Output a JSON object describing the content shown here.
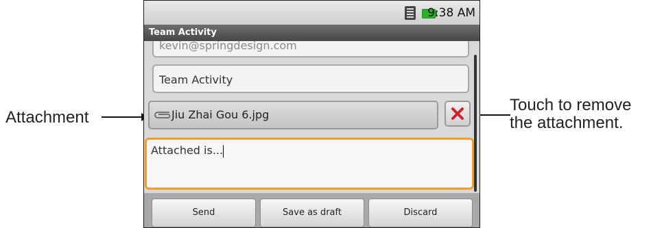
{
  "annotations": {
    "attachment_label": "Attachment",
    "remove_label_line1": "Touch to remove",
    "remove_label_line2": "the attachment."
  },
  "status_bar": {
    "time": "9:38 AM",
    "icons": [
      "signal-icon",
      "battery-icon"
    ]
  },
  "title_bar": {
    "title": "Team Activity"
  },
  "compose": {
    "to_value": "kevin@springdesign.com",
    "subject_value": "Team Activity",
    "attachment_name": "Jiu Zhai Gou 6.jpg",
    "body_value": "Attached is..."
  },
  "buttons": {
    "send": "Send",
    "save_draft": "Save as draft",
    "discard": "Discard"
  },
  "colors": {
    "focus_border": "#f29b2e",
    "remove_icon": "#d0202e",
    "battery_green": "#2bb02b"
  }
}
